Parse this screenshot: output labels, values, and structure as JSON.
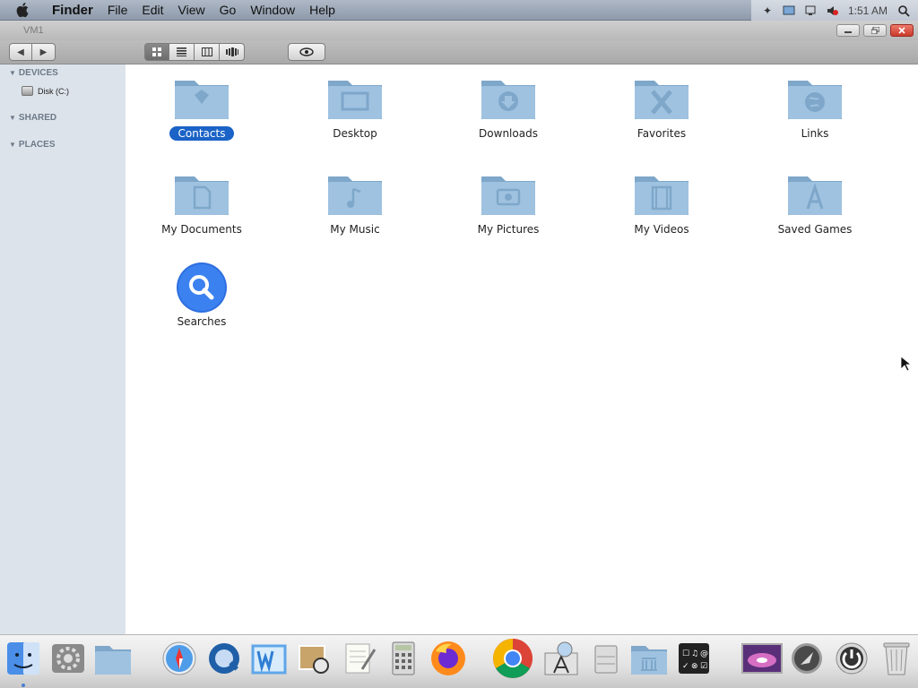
{
  "menubar": {
    "app_name": "Finder",
    "items": [
      "File",
      "Edit",
      "View",
      "Go",
      "Window",
      "Help"
    ],
    "clock": "1:51 AM"
  },
  "window": {
    "title": "VM1",
    "buttons": [
      "minimize",
      "restore",
      "close"
    ]
  },
  "toolbar": {
    "back_icon": "chevron-left-icon",
    "forward_icon": "chevron-right-icon",
    "views": [
      "icon-view",
      "list-view",
      "column-view",
      "coverflow-view"
    ],
    "active_view": "icon-view",
    "quicklook_icon": "eye-icon"
  },
  "sidebar": {
    "sections": [
      {
        "label": "DEVICES",
        "items": [
          {
            "label": "Disk (C:)",
            "icon": "disk-icon"
          }
        ]
      },
      {
        "label": "SHARED",
        "items": []
      },
      {
        "label": "PLACES",
        "items": []
      }
    ]
  },
  "files": [
    {
      "label": "Contacts",
      "icon": "contacts-folder-icon",
      "selected": true
    },
    {
      "label": "Desktop",
      "icon": "desktop-folder-icon",
      "selected": false
    },
    {
      "label": "Downloads",
      "icon": "downloads-folder-icon",
      "selected": false
    },
    {
      "label": "Favorites",
      "icon": "favorites-folder-icon",
      "selected": false
    },
    {
      "label": "Links",
      "icon": "links-folder-icon",
      "selected": false
    },
    {
      "label": "My Documents",
      "icon": "documents-folder-icon",
      "selected": false
    },
    {
      "label": "My Music",
      "icon": "music-folder-icon",
      "selected": false
    },
    {
      "label": "My Pictures",
      "icon": "pictures-folder-icon",
      "selected": false
    },
    {
      "label": "My Videos",
      "icon": "videos-folder-icon",
      "selected": false
    },
    {
      "label": "Saved Games",
      "icon": "games-folder-icon",
      "selected": false
    },
    {
      "label": "Searches",
      "icon": "searches-icon",
      "selected": false
    }
  ],
  "dock": [
    "finder-icon",
    "system-preferences-icon",
    "users-folder-icon",
    "safari-icon",
    "quicktime-icon",
    "word-icon",
    "photo-viewer-icon",
    "textedit-icon",
    "calculator-icon",
    "firefox-icon",
    "chrome-icon",
    "app-store-icon",
    "disk-utility-icon",
    "library-folder-icon",
    "control-panel-icon",
    "wallpaper-icon",
    "launchpad-icon",
    "power-icon",
    "trash-icon"
  ],
  "colors": {
    "selection": "#1b63c6",
    "sidebar_bg": "#dde3ea",
    "folder_blue": "#8fb6d8"
  }
}
